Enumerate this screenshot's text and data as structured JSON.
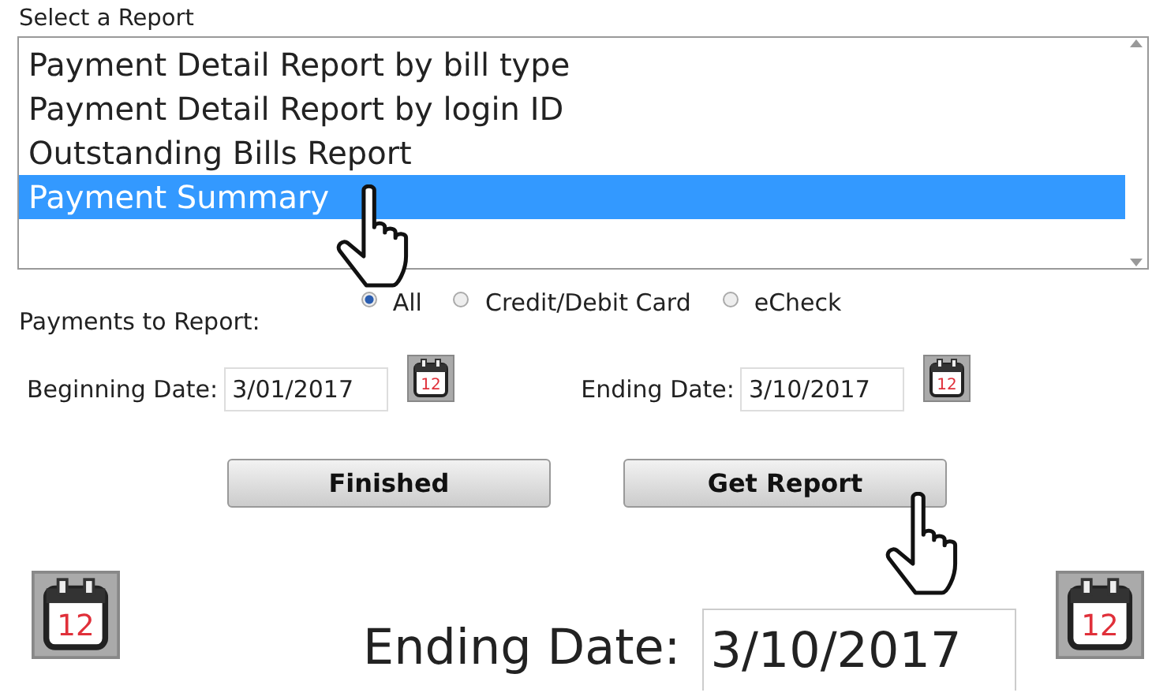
{
  "report_list": {
    "label": "Select a Report",
    "items": [
      {
        "label": "Payment Detail Report by bill type",
        "selected": false
      },
      {
        "label": "Payment Detail Report by login ID",
        "selected": false
      },
      {
        "label": "Outstanding Bills Report",
        "selected": false
      },
      {
        "label": "Payment Summary",
        "selected": true
      }
    ]
  },
  "payments": {
    "label": "Payments to Report:",
    "options": [
      {
        "label": "All",
        "selected": true
      },
      {
        "label": "Credit/Debit Card",
        "selected": false
      },
      {
        "label": "eCheck",
        "selected": false
      }
    ]
  },
  "dates": [
    {
      "label": "Beginning Date:",
      "value": "3/01/2017",
      "calendar_day": "12"
    },
    {
      "label": "Ending Date:",
      "value": "3/10/2017",
      "calendar_day": "12"
    }
  ],
  "buttons": [
    "Finished",
    "Get Report"
  ],
  "zoomed": {
    "label": "Ending Date:",
    "value": "3/10/2017",
    "calendar_days": [
      "12",
      "12"
    ]
  }
}
